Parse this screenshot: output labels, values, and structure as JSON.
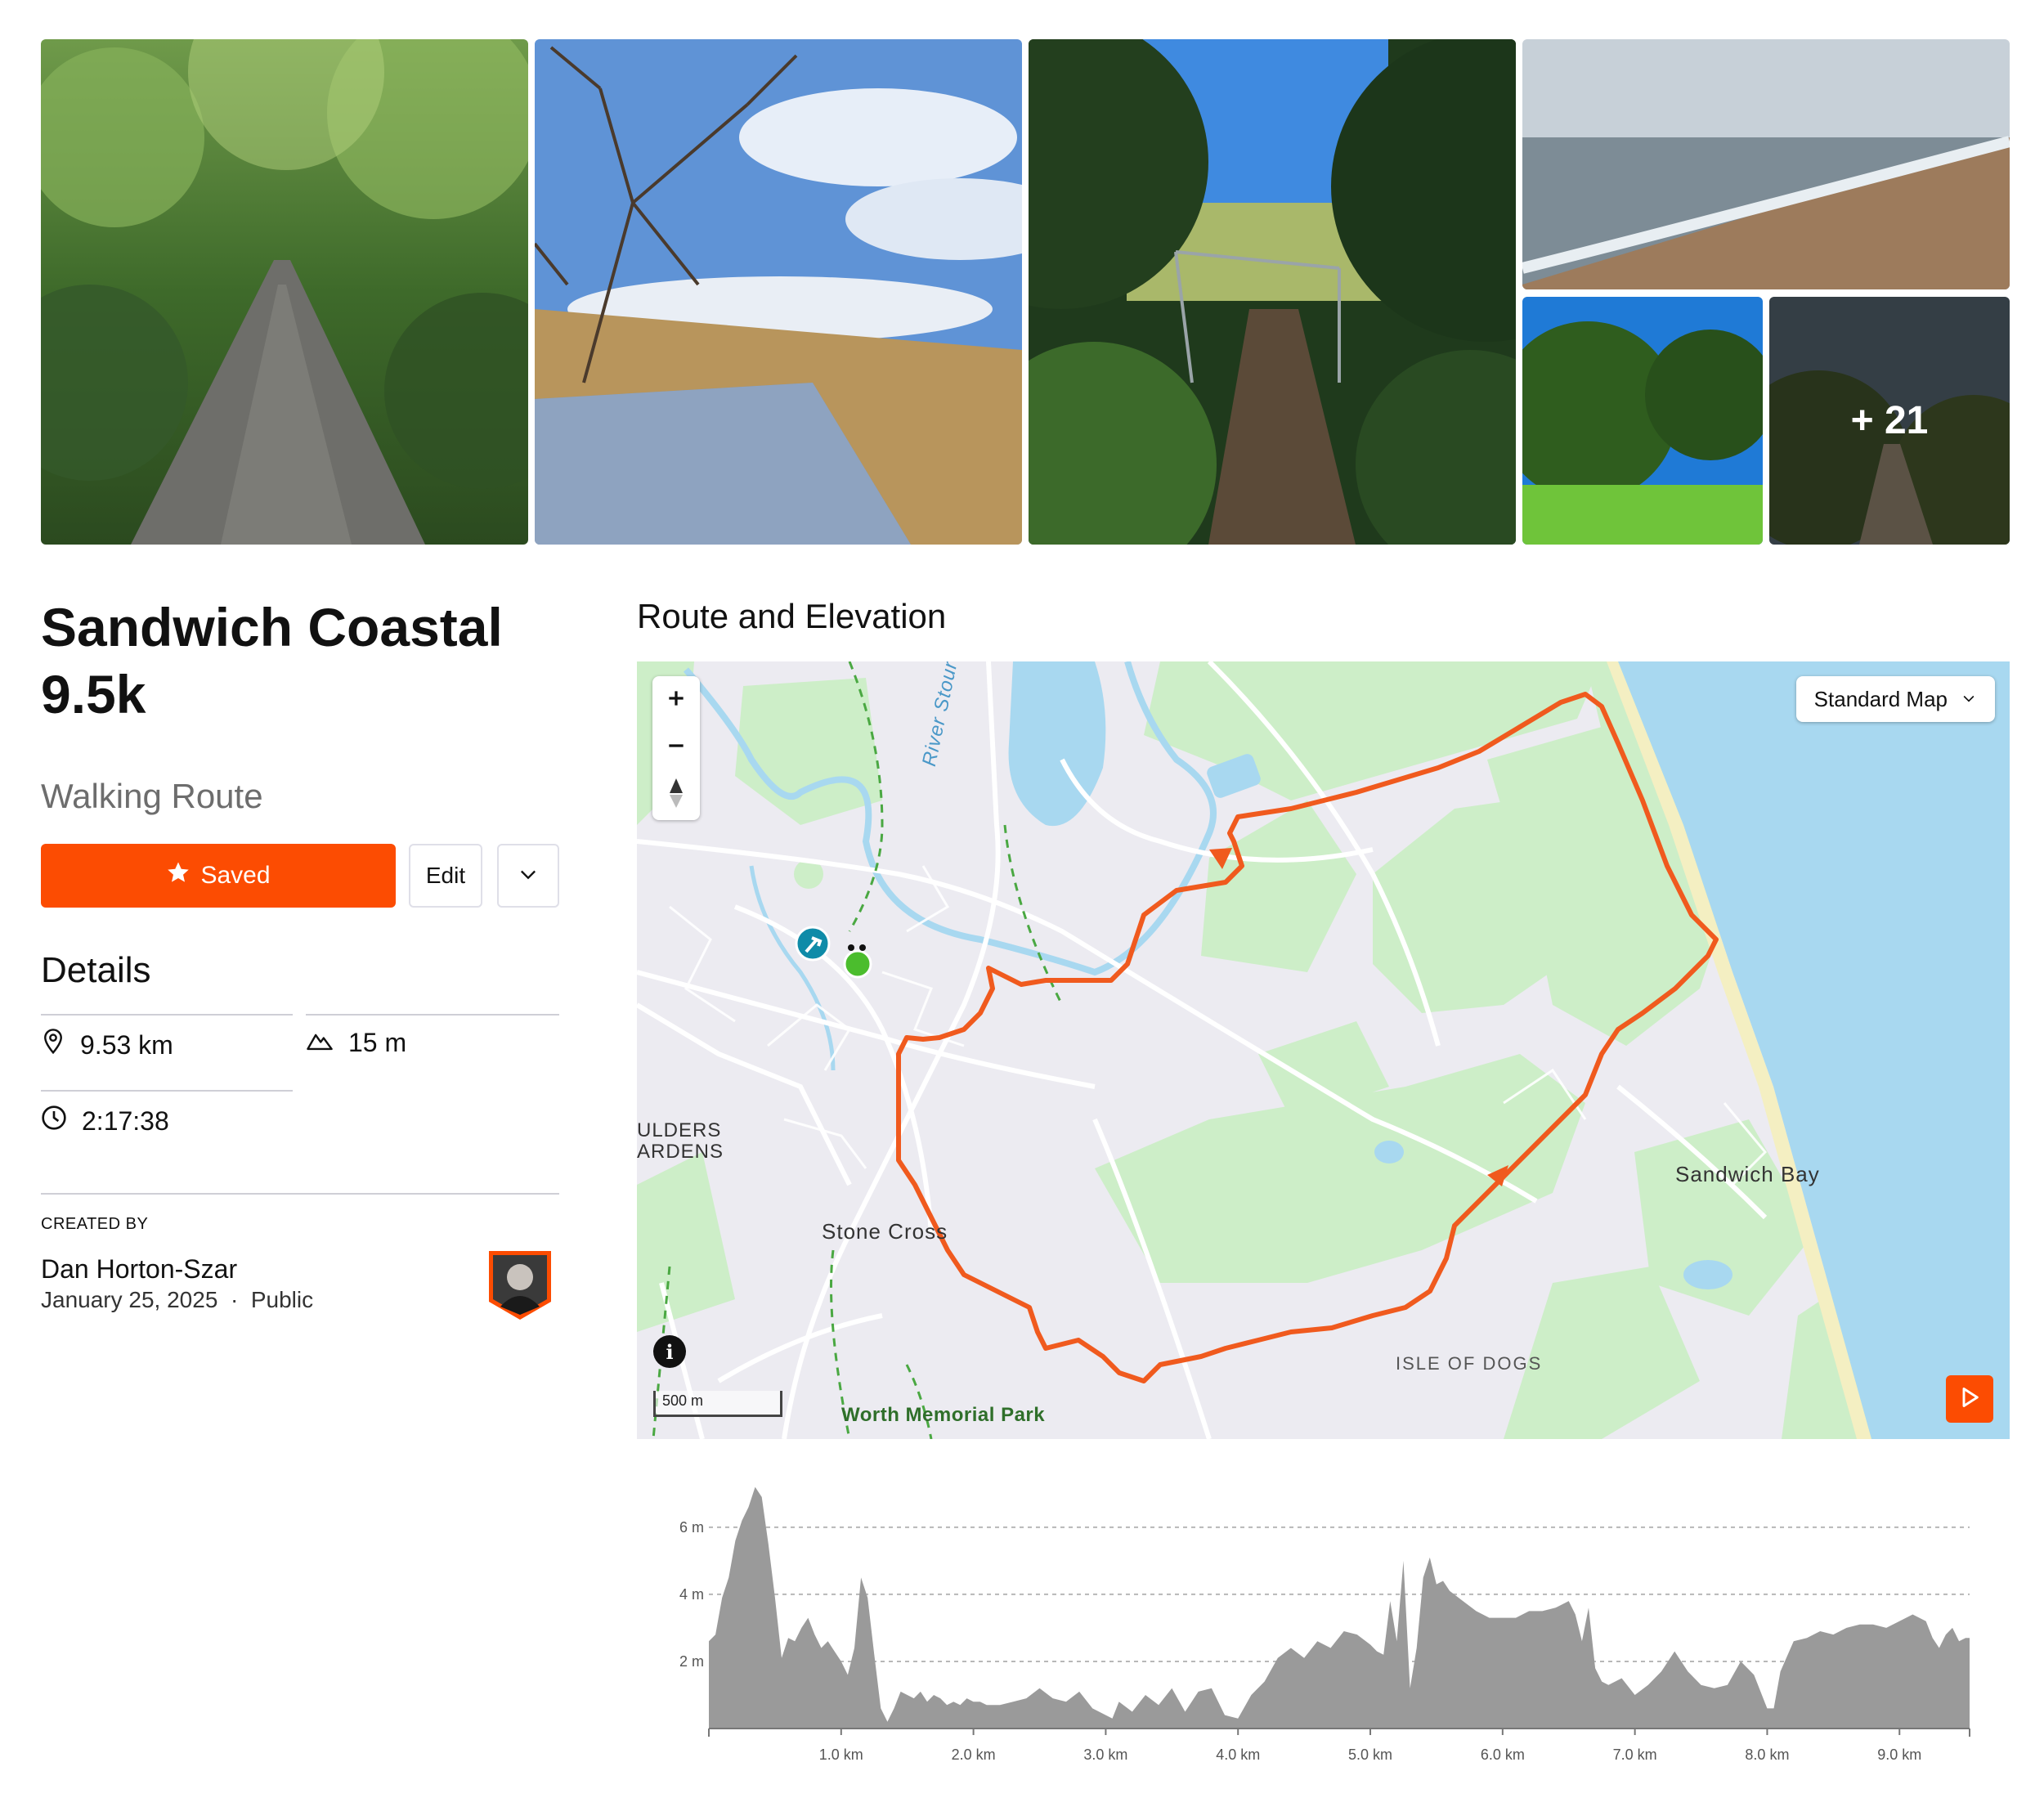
{
  "photos": {
    "more_count": "+ 21"
  },
  "route": {
    "title": "Sandwich Coastal 9.5k",
    "type": "Walking Route",
    "saved_label": "Saved",
    "edit_label": "Edit"
  },
  "details": {
    "heading": "Details",
    "distance": "9.53 km",
    "elevation_gain": "15 m",
    "time": "2:17:38"
  },
  "creator": {
    "label": "CREATED BY",
    "name": "Dan Horton-Szar",
    "date": "January 25, 2025",
    "visibility": "Public"
  },
  "map": {
    "section_title": "Route and Elevation",
    "map_type": "Standard Map",
    "scale": "500 m",
    "labels": {
      "river": "River Stour",
      "boulders": "ULDERS",
      "gardens": "ARDENS",
      "stone_cross": "Stone Cross",
      "sandwich_bay": "Sandwich Bay",
      "isle_of_dogs": "ISLE OF DOGS",
      "worth_park": "Worth Memorial Park"
    },
    "route_color": "#f05a1e",
    "water_color": "#a8d8f0",
    "green_color": "#cdeec8"
  },
  "chart_data": {
    "type": "area",
    "xlabel": "",
    "ylabel": "",
    "xlim": [
      0,
      9.53
    ],
    "ylim": [
      0,
      7.8
    ],
    "x_ticks": [
      1.0,
      2.0,
      3.0,
      4.0,
      5.0,
      6.0,
      7.0,
      8.0,
      9.0
    ],
    "x_tick_labels": [
      "1.0 km",
      "2.0 km",
      "3.0 km",
      "4.0 km",
      "5.0 km",
      "6.0 km",
      "7.0 km",
      "8.0 km",
      "9.0 km"
    ],
    "y_ticks": [
      2,
      4,
      6
    ],
    "y_tick_labels": [
      "2 m",
      "4 m",
      "6 m"
    ],
    "grid": true,
    "fill_color": "#9a9a9a",
    "x": [
      0.0,
      0.05,
      0.1,
      0.15,
      0.2,
      0.25,
      0.3,
      0.35,
      0.4,
      0.45,
      0.5,
      0.55,
      0.6,
      0.65,
      0.7,
      0.75,
      0.8,
      0.85,
      0.9,
      0.95,
      1.0,
      1.05,
      1.1,
      1.15,
      1.2,
      1.25,
      1.3,
      1.35,
      1.4,
      1.45,
      1.5,
      1.55,
      1.6,
      1.65,
      1.7,
      1.75,
      1.8,
      1.85,
      1.9,
      1.95,
      2.0,
      2.05,
      2.1,
      2.2,
      2.3,
      2.4,
      2.5,
      2.6,
      2.7,
      2.8,
      2.9,
      3.0,
      3.05,
      3.1,
      3.2,
      3.3,
      3.4,
      3.5,
      3.6,
      3.7,
      3.8,
      3.9,
      4.0,
      4.1,
      4.2,
      4.3,
      4.4,
      4.5,
      4.6,
      4.7,
      4.8,
      4.9,
      5.0,
      5.05,
      5.1,
      5.15,
      5.2,
      5.25,
      5.3,
      5.35,
      5.4,
      5.45,
      5.5,
      5.55,
      5.6,
      5.7,
      5.8,
      5.9,
      6.0,
      6.1,
      6.2,
      6.3,
      6.4,
      6.5,
      6.55,
      6.6,
      6.65,
      6.7,
      6.75,
      6.8,
      6.9,
      7.0,
      7.1,
      7.2,
      7.3,
      7.4,
      7.5,
      7.6,
      7.7,
      7.8,
      7.9,
      8.0,
      8.05,
      8.1,
      8.2,
      8.3,
      8.4,
      8.5,
      8.6,
      8.7,
      8.8,
      8.9,
      9.0,
      9.1,
      9.2,
      9.25,
      9.3,
      9.35,
      9.4,
      9.45,
      9.5,
      9.53
    ],
    "y": [
      2.6,
      2.8,
      3.9,
      4.5,
      5.6,
      6.2,
      6.6,
      7.2,
      6.9,
      5.5,
      3.9,
      2.1,
      2.7,
      2.6,
      3.0,
      3.3,
      2.8,
      2.4,
      2.6,
      2.3,
      2.0,
      1.6,
      2.4,
      4.5,
      3.9,
      2.2,
      0.6,
      0.2,
      0.6,
      1.1,
      1.0,
      0.9,
      1.1,
      0.8,
      1.0,
      0.9,
      0.7,
      0.8,
      0.7,
      0.9,
      0.8,
      0.8,
      0.7,
      0.7,
      0.8,
      0.9,
      1.2,
      0.9,
      0.8,
      1.1,
      0.6,
      0.4,
      0.3,
      0.8,
      0.5,
      1.0,
      0.7,
      1.2,
      0.5,
      1.1,
      1.2,
      0.4,
      0.3,
      1.0,
      1.4,
      2.1,
      2.4,
      2.1,
      2.6,
      2.4,
      2.9,
      2.8,
      2.5,
      2.3,
      2.2,
      3.8,
      2.6,
      5.0,
      1.2,
      2.4,
      4.5,
      5.1,
      4.3,
      4.4,
      4.1,
      3.8,
      3.5,
      3.3,
      3.3,
      3.3,
      3.5,
      3.5,
      3.6,
      3.8,
      3.4,
      2.6,
      3.6,
      1.8,
      1.4,
      1.3,
      1.5,
      1.0,
      1.3,
      1.7,
      2.3,
      1.7,
      1.3,
      1.2,
      1.3,
      2.0,
      1.6,
      0.6,
      0.6,
      1.7,
      2.6,
      2.7,
      2.9,
      2.8,
      3.0,
      3.1,
      3.1,
      3.0,
      3.2,
      3.4,
      3.2,
      2.7,
      2.4,
      2.8,
      3.0,
      2.6,
      2.7,
      2.7
    ]
  }
}
